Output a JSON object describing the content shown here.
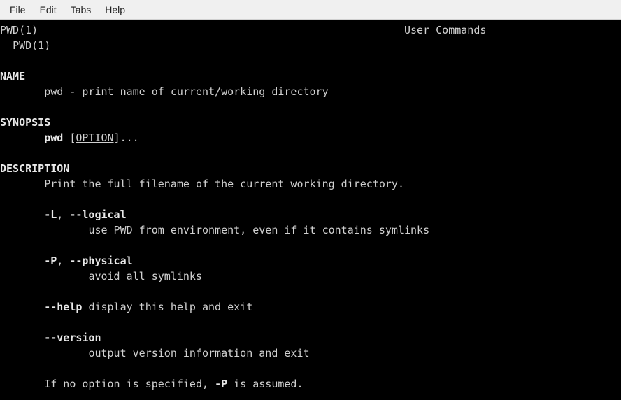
{
  "menubar": {
    "file": "File",
    "edit": "Edit",
    "tabs": "Tabs",
    "help": "Help"
  },
  "man": {
    "hdr_left": "PWD(1)",
    "hdr_center": "User Commands",
    "hdr_right": "PWD(1)",
    "sec_name": "NAME",
    "name_line": "pwd - print name of current/working directory",
    "sec_synopsis": "SYNOPSIS",
    "syn_cmd": "pwd",
    "syn_opt": "OPTION",
    "syn_tail": "]...",
    "sec_description": "DESCRIPTION",
    "desc_intro": "Print the full filename of the current working directory.",
    "opt_L": "-L",
    "opt_logical": "--logical",
    "opt_L_desc": "use PWD from environment, even if it contains symlinks",
    "opt_P": "-P",
    "opt_physical": "--physical",
    "opt_P_desc": "avoid all symlinks",
    "opt_help": "--help",
    "opt_help_desc": "display this help and exit",
    "opt_version": "--version",
    "opt_version_desc": "output version information and exit",
    "note_pre": "If no option is specified, ",
    "note_bold": "-P",
    "note_post": " is assumed.",
    "comma_sep": ", "
  }
}
